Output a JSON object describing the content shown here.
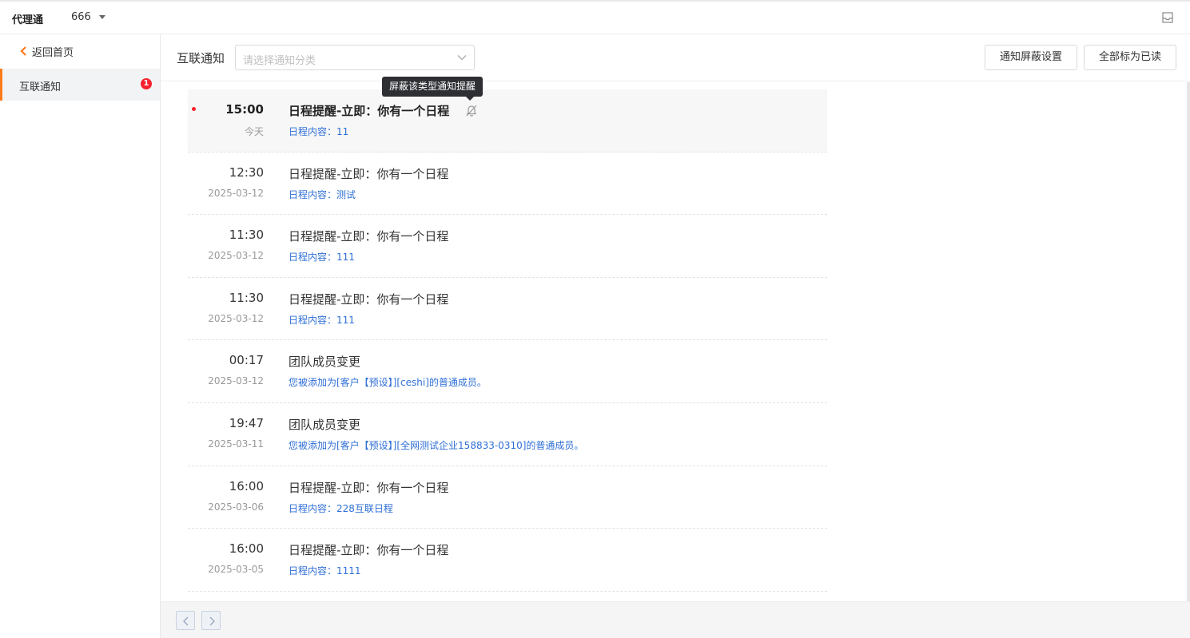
{
  "topbar": {
    "app_name": "代理通",
    "org_name": "666"
  },
  "sidebar": {
    "back_label": "返回首页",
    "items": [
      {
        "label": "互联通知",
        "badge": "1"
      }
    ]
  },
  "header": {
    "title": "互联通知",
    "category_placeholder": "请选择通知分类",
    "mute_settings_label": "通知屏蔽设置",
    "mark_all_read_label": "全部标为已读"
  },
  "tooltip": "屏蔽该类型通知提醒",
  "notifications": [
    {
      "time": "15:00",
      "date": "今天",
      "title": "日程提醒-立即：你有一个日程",
      "content": "日程内容：11",
      "unread": true
    },
    {
      "time": "12:30",
      "date": "2025-03-12",
      "title": "日程提醒-立即：你有一个日程",
      "content": "日程内容：测试",
      "unread": false
    },
    {
      "time": "11:30",
      "date": "2025-03-12",
      "title": "日程提醒-立即：你有一个日程",
      "content": "日程内容：111",
      "unread": false
    },
    {
      "time": "11:30",
      "date": "2025-03-12",
      "title": "日程提醒-立即：你有一个日程",
      "content": "日程内容：111",
      "unread": false
    },
    {
      "time": "00:17",
      "date": "2025-03-12",
      "title": "团队成员变更",
      "content": "您被添加为[客户【预设】][ceshi]的普通成员。",
      "unread": false
    },
    {
      "time": "19:47",
      "date": "2025-03-11",
      "title": "团队成员变更",
      "content": "您被添加为[客户【预设】][全网测试企业158833-0310]的普通成员。",
      "unread": false
    },
    {
      "time": "16:00",
      "date": "2025-03-06",
      "title": "日程提醒-立即：你有一个日程",
      "content": "日程内容：228互联日程",
      "unread": false
    },
    {
      "time": "16:00",
      "date": "2025-03-05",
      "title": "日程提醒-立即：你有一个日程",
      "content": "日程内容：1111",
      "unread": false
    }
  ],
  "colors": {
    "accent": "#ff7a1a",
    "link": "#2f6fd6",
    "badge": "#f5222d"
  },
  "icons": {
    "back": "chevron-left-icon",
    "mute": "bell-off-icon",
    "inbox": "inbox-icon"
  }
}
